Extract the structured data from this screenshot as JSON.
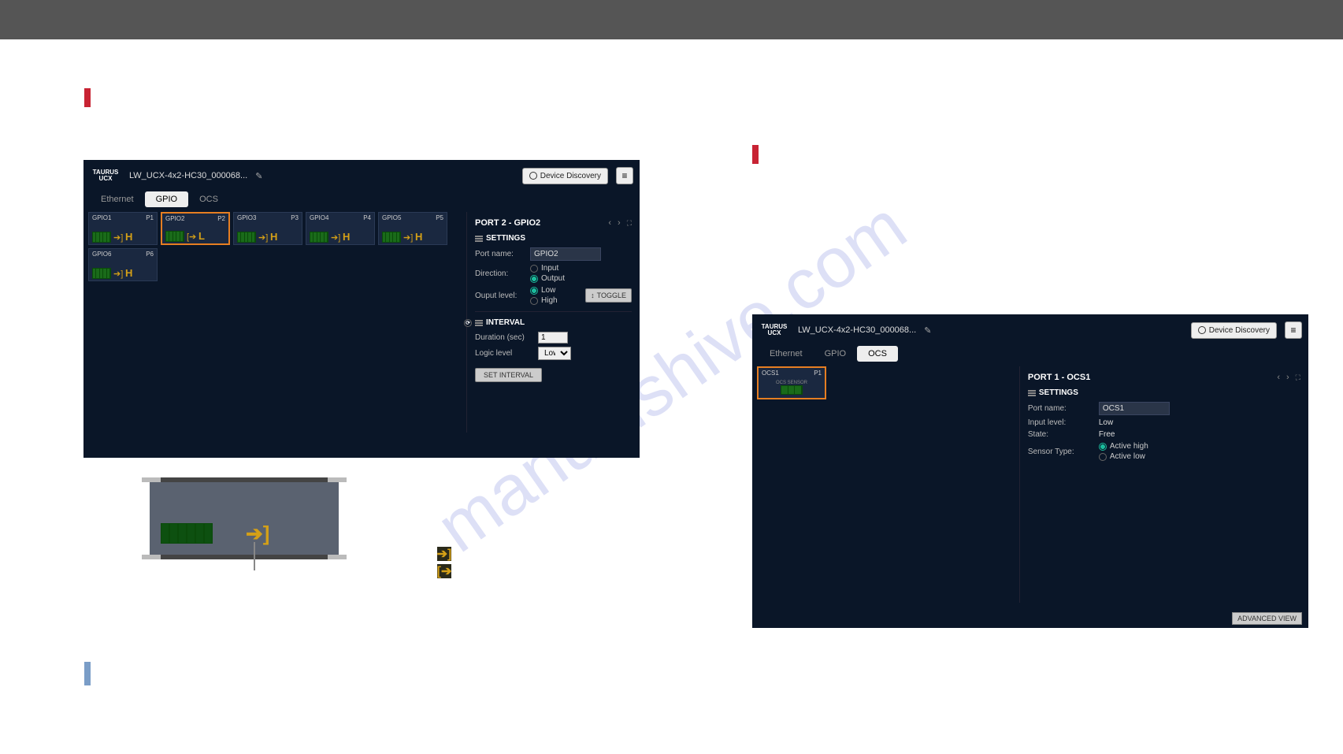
{
  "window1": {
    "device_name": "LW_UCX-4x2-HC30_000068...",
    "discovery_btn": "Device Discovery",
    "tabs": {
      "ethernet": "Ethernet",
      "gpio": "GPIO",
      "ocs": "OCS"
    },
    "cards": [
      {
        "name": "GPIO1",
        "pnum": "P1",
        "level": "H",
        "selected": false
      },
      {
        "name": "GPIO2",
        "pnum": "P2",
        "level": "L",
        "selected": true
      },
      {
        "name": "GPIO3",
        "pnum": "P3",
        "level": "H",
        "selected": false
      },
      {
        "name": "GPIO4",
        "pnum": "P4",
        "level": "H",
        "selected": false
      },
      {
        "name": "GPIO5",
        "pnum": "P5",
        "level": "H",
        "selected": false
      },
      {
        "name": "GPIO6",
        "pnum": "P6",
        "level": "H",
        "selected": false
      }
    ],
    "details": {
      "title": "PORT 2 - GPIO2",
      "settings_title": "SETTINGS",
      "portname_label": "Port name:",
      "portname_value": "GPIO2",
      "direction_label": "Direction:",
      "dir_input": "Input",
      "dir_output": "Output",
      "outlevel_label": "Ouput level:",
      "lvl_low": "Low",
      "lvl_high": "High",
      "toggle_btn": "TOGGLE",
      "interval_title": "INTERVAL",
      "duration_label": "Duration (sec)",
      "duration_value": "1",
      "logic_label": "Logic level",
      "logic_value": "Low",
      "set_btn": "SET INTERVAL"
    }
  },
  "window2": {
    "device_name": "LW_UCX-4x2-HC30_000068...",
    "discovery_btn": "Device Discovery",
    "tabs": {
      "ethernet": "Ethernet",
      "gpio": "GPIO",
      "ocs": "OCS"
    },
    "cards": [
      {
        "name": "OCS1",
        "pnum": "P1",
        "sub": "OCS SENSOR"
      }
    ],
    "details": {
      "title": "PORT 1 - OCS1",
      "settings_title": "SETTINGS",
      "portname_label": "Port name:",
      "portname_value": "OCS1",
      "inputlevel_label": "Input level:",
      "inputlevel_value": "Low",
      "state_label": "State:",
      "state_value": "Free",
      "sensor_label": "Sensor Type:",
      "sensor_high": "Active high",
      "sensor_low": "Active low"
    },
    "adv_btn": "ADVANCED VIEW"
  },
  "logo": {
    "line1": "TAURUS",
    "line2": "UCX"
  }
}
